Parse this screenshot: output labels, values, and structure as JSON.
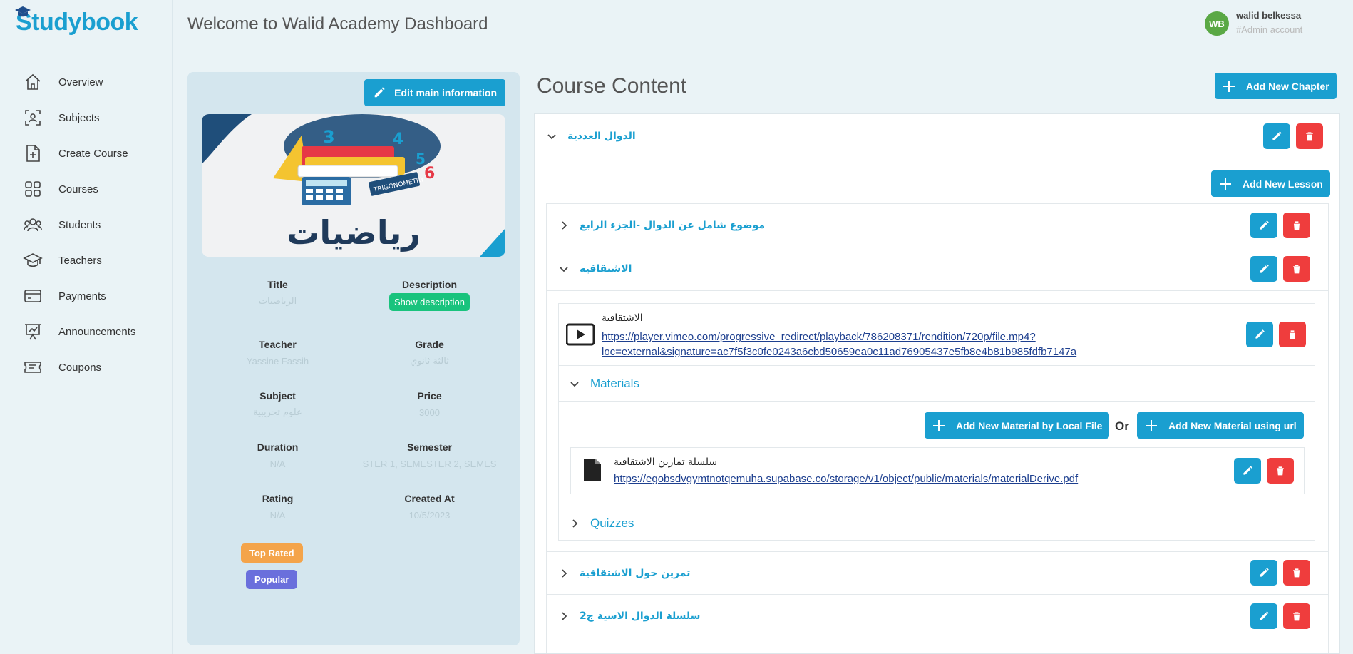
{
  "brand": {
    "name": "Studybook"
  },
  "header": {
    "title": "Welcome to Walid Academy Dashboard"
  },
  "user": {
    "initials": "WB",
    "name": "walid belkessa",
    "role": "#Admin account"
  },
  "sidebar": {
    "items": [
      {
        "label": "Overview",
        "icon": "home-icon"
      },
      {
        "label": "Subjects",
        "icon": "subjects-icon"
      },
      {
        "label": "Create Course",
        "icon": "file-plus-icon"
      },
      {
        "label": "Courses",
        "icon": "grid-icon"
      },
      {
        "label": "Students",
        "icon": "users-icon"
      },
      {
        "label": "Teachers",
        "icon": "graduation-cap-icon"
      },
      {
        "label": "Payments",
        "icon": "credit-card-icon"
      },
      {
        "label": "Announcements",
        "icon": "presentation-icon"
      },
      {
        "label": "Coupons",
        "icon": "ticket-icon"
      }
    ]
  },
  "course_info": {
    "edit_label": "Edit main information",
    "cover_text": "رياضيات",
    "cover_banner": "TRIGONOMETRY",
    "title_label": "Title",
    "title_value": "الرياضيات",
    "description_label": "Description",
    "show_description": "Show description",
    "teacher_label": "Teacher",
    "teacher_value": "Yassine Fassih",
    "grade_label": "Grade",
    "grade_value": "ثالثة ثانوي",
    "subject_label": "Subject",
    "subject_value": "علوم تجريبية",
    "price_label": "Price",
    "price_value": "3000",
    "duration_label": "Duration",
    "duration_value": "N/A",
    "semester_label": "Semester",
    "semester_value": "STER 1, SEMESTER 2, SEMES",
    "rating_label": "Rating",
    "rating_value": "N/A",
    "created_label": "Created At",
    "created_value": "10/5/2023",
    "badge_top": "Top Rated",
    "badge_popular": "Popular"
  },
  "content": {
    "title": "Course Content",
    "add_chapter": "Add New Chapter",
    "chapter_title": "الدوال العددية",
    "add_lesson": "Add New Lesson",
    "lessons": [
      "موضوع شامل عن الدوال -الجزء الرابع",
      "الاشتقاقية",
      "تمرين حول الاشتقاقية",
      "سلسلة الدوال الاسية ج2"
    ],
    "video_title": "الاشتقاقية",
    "video_url_1": "https://player.vimeo.com/progressive_redirect/playback/786208371/rendition/720p/file.mp4?",
    "video_url_2": "loc=external&signature=ac7f5f3c0fe0243a6cbd50659ea0c11ad76905437e5fb8e4b81b985fdfb7147a",
    "materials_label": "Materials",
    "add_material_local": "Add New Material by Local File",
    "or_label": "Or",
    "add_material_url": "Add New Material using url",
    "material_title": "سلسلة تمارين الاشتقاقية",
    "material_url": "https://egobsdvgymtnotqemuha.supabase.co/storage/v1/object/public/materials/materialDerive.pdf",
    "quizzes_label": "Quizzes"
  }
}
